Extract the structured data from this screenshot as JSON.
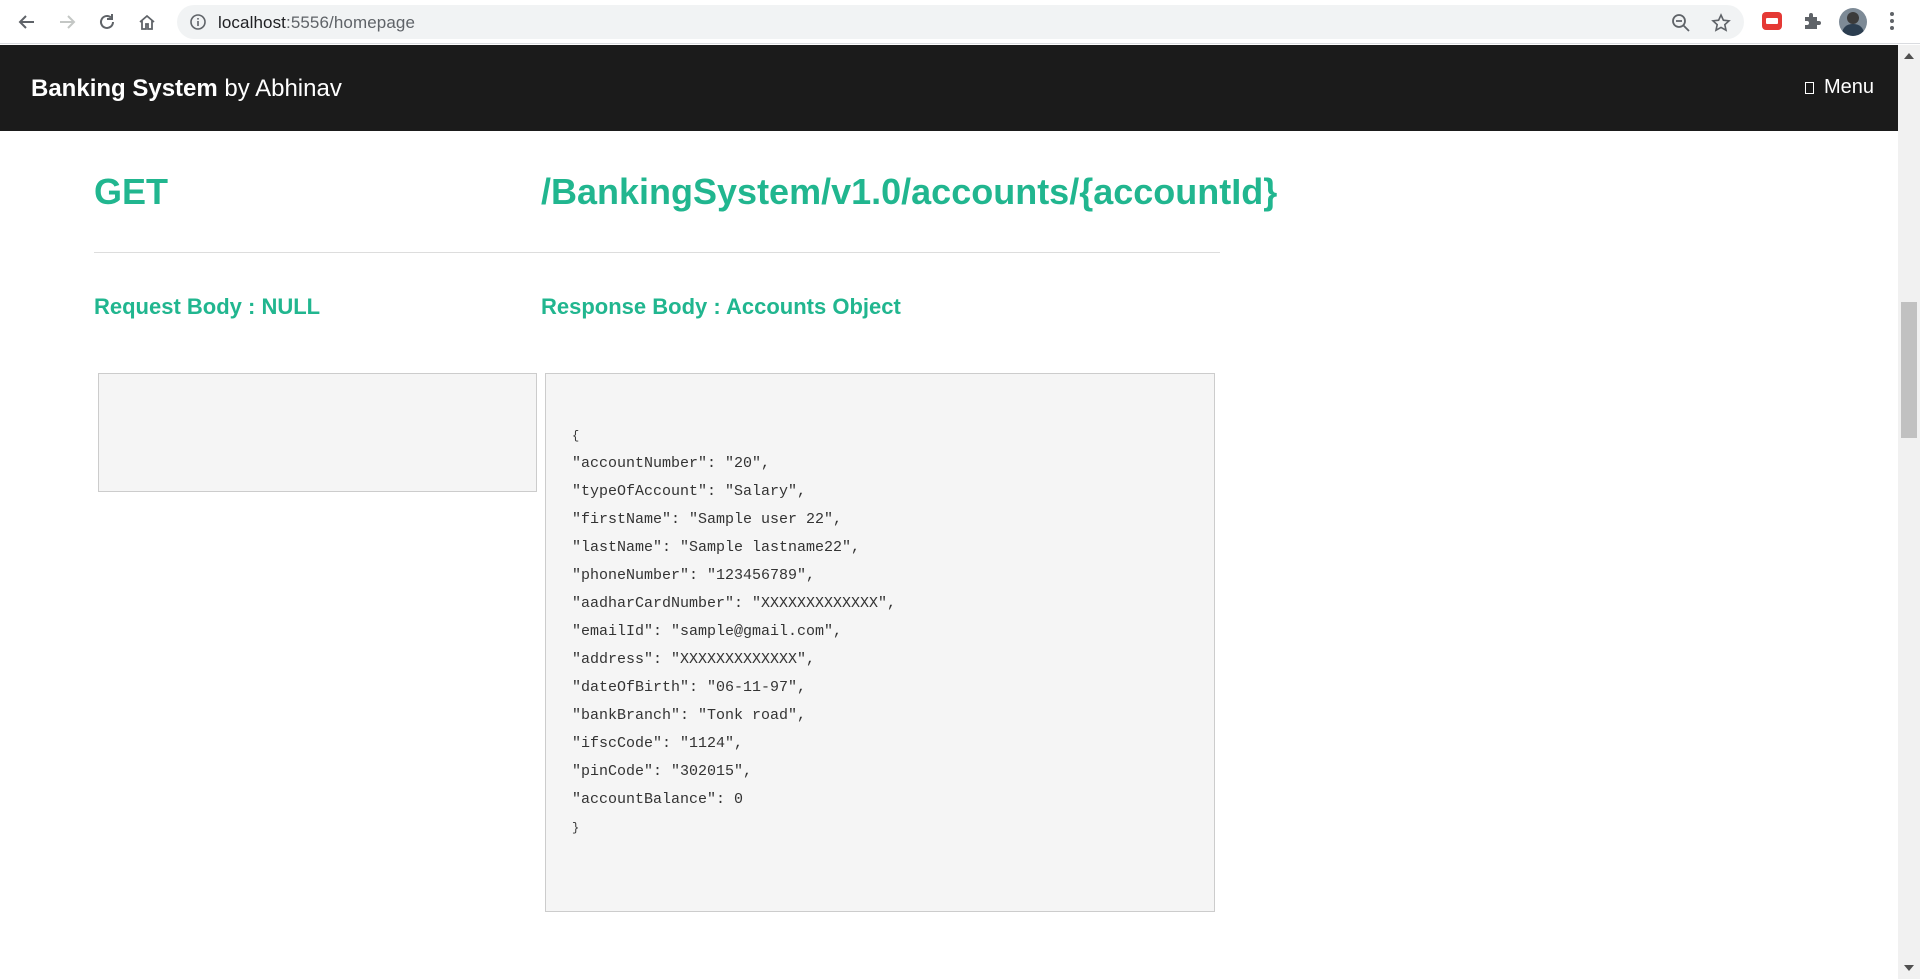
{
  "browser": {
    "url_host": "localhost",
    "url_path": ":5556/homepage",
    "icons": [
      "back-icon",
      "forward-icon",
      "reload-icon",
      "home-icon",
      "info-icon",
      "zoom-icon",
      "bookmark-star-icon",
      "extension-red-icon",
      "extensions-puzzle-icon",
      "profile-avatar",
      "more-vert-icon"
    ]
  },
  "header": {
    "brand_bold": "Banking System",
    "brand_by": " by Abhinav",
    "menu_label": "Menu"
  },
  "endpoint": {
    "method": "GET",
    "path": "/BankingSystem/v1.0/accounts/{accountId}"
  },
  "request": {
    "title": "Request Body : NULL",
    "body": ""
  },
  "response": {
    "title": "Response Body : Accounts Object",
    "lines": [
      "{",
      "\"accountNumber\": \"20\",",
      "\"typeOfAccount\": \"Salary\",",
      "\"firstName\": \"Sample user 22\",",
      "\"lastName\": \"Sample lastname22\",",
      "\"phoneNumber\": \"123456789\",",
      "\"aadharCardNumber\": \"XXXXXXXXXXXXX\",",
      "\"emailId\": \"sample@gmail.com\",",
      "\"address\": \"XXXXXXXXXXXXX\",",
      "\"dateOfBirth\": \"06-11-97\",",
      "\"bankBranch\": \"Tonk road\",",
      "\"ifscCode\": \"1124\",",
      "\"pinCode\": \"302015\",",
      "\"accountBalance\": 0",
      "}"
    ]
  },
  "colors": {
    "accent": "#21b68f",
    "header_bg": "#1b1b1b",
    "code_bg": "#f5f5f5"
  }
}
